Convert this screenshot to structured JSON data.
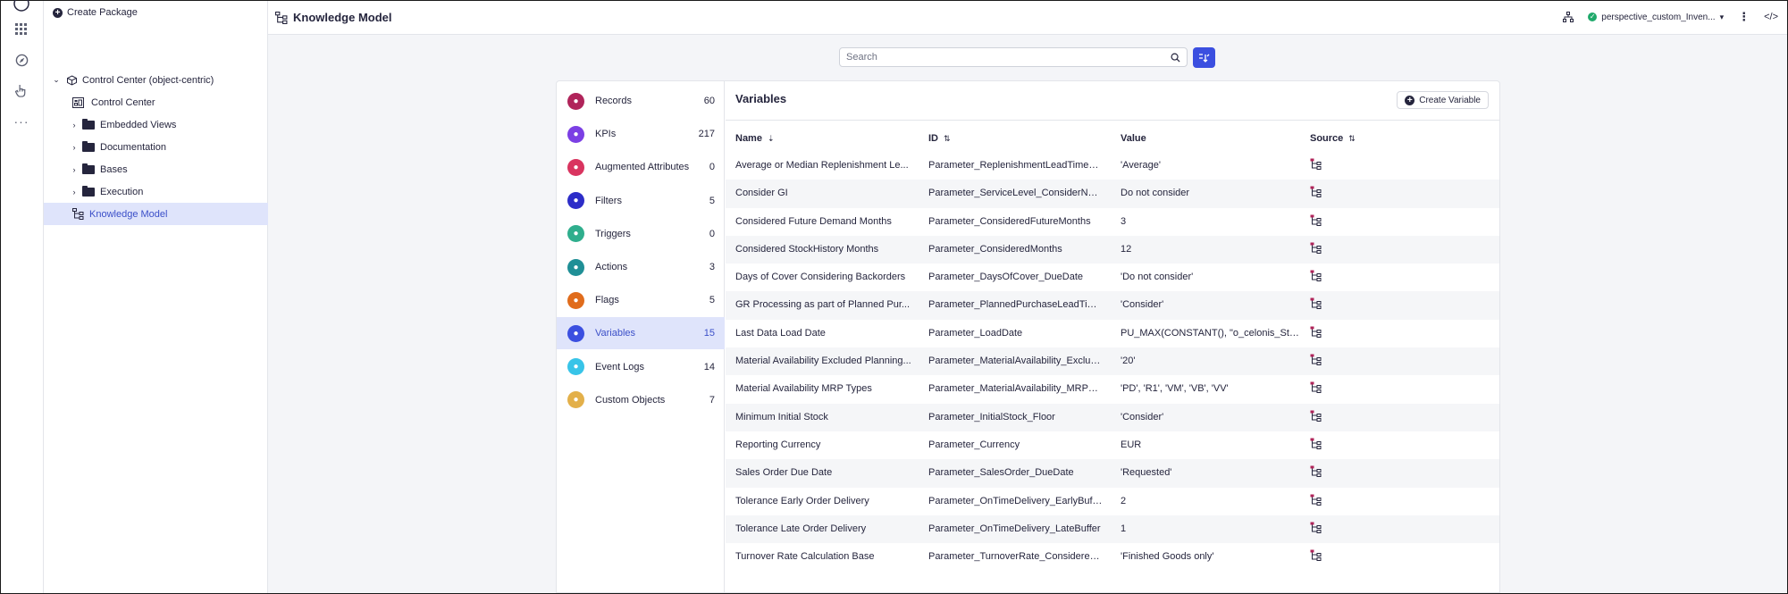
{
  "sidebar": {
    "create_package": "Create Package",
    "tree": [
      {
        "label": "Control Center (object-centric)",
        "type": "root"
      },
      {
        "label": "Control Center",
        "type": "view"
      },
      {
        "label": "Embedded Views",
        "type": "folder"
      },
      {
        "label": "Documentation",
        "type": "folder"
      },
      {
        "label": "Bases",
        "type": "folder"
      },
      {
        "label": "Execution",
        "type": "folder"
      },
      {
        "label": "Knowledge Model",
        "type": "model",
        "selected": true
      }
    ]
  },
  "header": {
    "title": "Knowledge Model",
    "perspective": "perspective_custom_Inven..."
  },
  "search": {
    "placeholder": "Search"
  },
  "categories": [
    {
      "label": "Records",
      "count": "60",
      "color": "#b0245a",
      "icon": "records-icon"
    },
    {
      "label": "KPIs",
      "count": "217",
      "color": "#7b3fe4",
      "icon": "kpi-icon"
    },
    {
      "label": "Augmented Attributes",
      "count": "0",
      "color": "#d9345f",
      "icon": "augmented-attributes-icon"
    },
    {
      "label": "Filters",
      "count": "5",
      "color": "#2d2dc8",
      "icon": "filter-icon"
    },
    {
      "label": "Triggers",
      "count": "0",
      "color": "#2fae8d",
      "icon": "trigger-icon"
    },
    {
      "label": "Actions",
      "count": "3",
      "color": "#1f8f96",
      "icon": "action-icon"
    },
    {
      "label": "Flags",
      "count": "5",
      "color": "#e06c1c",
      "icon": "flag-icon"
    },
    {
      "label": "Variables",
      "count": "15",
      "color": "#3b4fe0",
      "icon": "variable-icon",
      "selected": true
    },
    {
      "label": "Event Logs",
      "count": "14",
      "color": "#38c4e8",
      "icon": "event-log-icon"
    },
    {
      "label": "Custom Objects",
      "count": "7",
      "color": "#e3b04a",
      "icon": "custom-object-icon"
    }
  ],
  "main": {
    "title": "Variables",
    "create_button": "Create Variable",
    "columns": [
      "Name",
      "ID",
      "Value",
      "Source"
    ],
    "rows": [
      {
        "name": "Average or Median Replenishment Le...",
        "id": "Parameter_ReplenishmentLeadTime_A...",
        "value": "'Average'"
      },
      {
        "name": "Consider GI",
        "id": "Parameter_ServiceLevel_ConsiderNoGI",
        "value": "Do not consider"
      },
      {
        "name": "Considered Future Demand Months",
        "id": "Parameter_ConsideredFutureMonths",
        "value": "3"
      },
      {
        "name": "Considered StockHistory Months",
        "id": "Parameter_ConsideredMonths",
        "value": "12"
      },
      {
        "name": "Days of Cover Considering Backorders",
        "id": "Parameter_DaysOfCover_DueDate",
        "value": "'Do not consider'"
      },
      {
        "name": "GR Processing as part of Planned Pur...",
        "id": "Parameter_PlannedPurchaseLeadTime...",
        "value": "'Consider'"
      },
      {
        "name": "Last Data Load Date",
        "id": "Parameter_LoadDate",
        "value": "PU_MAX(CONSTANT(), \"o_celonis_Sto..."
      },
      {
        "name": "Material Availability Excluded Planning...",
        "id": "Parameter_MaterialAvailability_Exclude...",
        "value": "'20'"
      },
      {
        "name": "Material Availability MRP Types",
        "id": "Parameter_MaterialAvailability_MRPType",
        "value": "'PD', 'R1', 'VM', 'VB', 'VV'"
      },
      {
        "name": "Minimum Initial Stock",
        "id": "Parameter_InitialStock_Floor",
        "value": "'Consider'"
      },
      {
        "name": "Reporting Currency",
        "id": "Parameter_Currency",
        "value": "EUR"
      },
      {
        "name": "Sales Order Due Date",
        "id": "Parameter_SalesOrder_DueDate",
        "value": "'Requested'"
      },
      {
        "name": "Tolerance Early Order Delivery",
        "id": "Parameter_OnTimeDelivery_EarlyBuffer",
        "value": "2"
      },
      {
        "name": "Tolerance Late Order Delivery",
        "id": "Parameter_OnTimeDelivery_LateBuffer",
        "value": "1"
      },
      {
        "name": "Turnover Rate Calculation Base",
        "id": "Parameter_TurnoverRate_ConsideredI...",
        "value": "'Finished Goods only'"
      }
    ]
  }
}
